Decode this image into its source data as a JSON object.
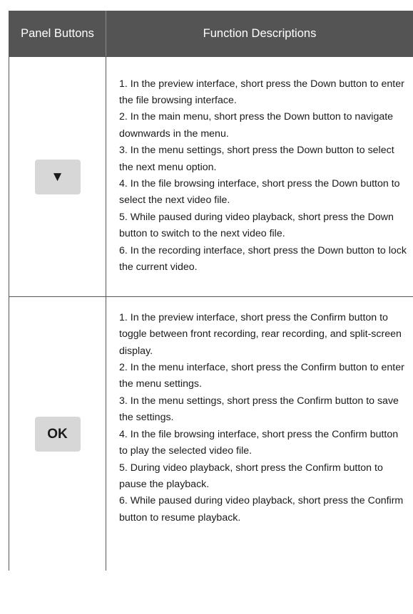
{
  "table": {
    "headers": [
      "Panel Buttons",
      "Function Descriptions"
    ],
    "rows": [
      {
        "button_label": "▼",
        "descriptions": [
          "1. In the preview interface, short press the Down button to enter the file browsing interface.",
          "2. In the main menu, short press the Down button to navigate downwards in the menu.",
          "3. In the menu settings, short press the Down button to select the next menu option.",
          "4. In the file browsing interface, short press the Down button to select the next video file.",
          "5. While paused during video playback, short press the Down button to switch to the next video file.",
          "6. In the recording interface, short press the Down button to lock the current video."
        ]
      },
      {
        "button_label": "OK",
        "descriptions": [
          "1. In the preview interface, short press the Confirm button to toggle between front recording, rear recording, and split-screen display.",
          "2. In the menu interface, short press the Confirm button to enter the menu settings.",
          "3. In the menu settings, short press the Confirm button to save the settings.",
          "4. In the file browsing interface, short press the Confirm button to play the selected video file.",
          "5. During video playback, short press the Confirm button to pause the playback.",
          "6. While paused during video playback, short press the Confirm button to resume playback."
        ]
      }
    ]
  }
}
